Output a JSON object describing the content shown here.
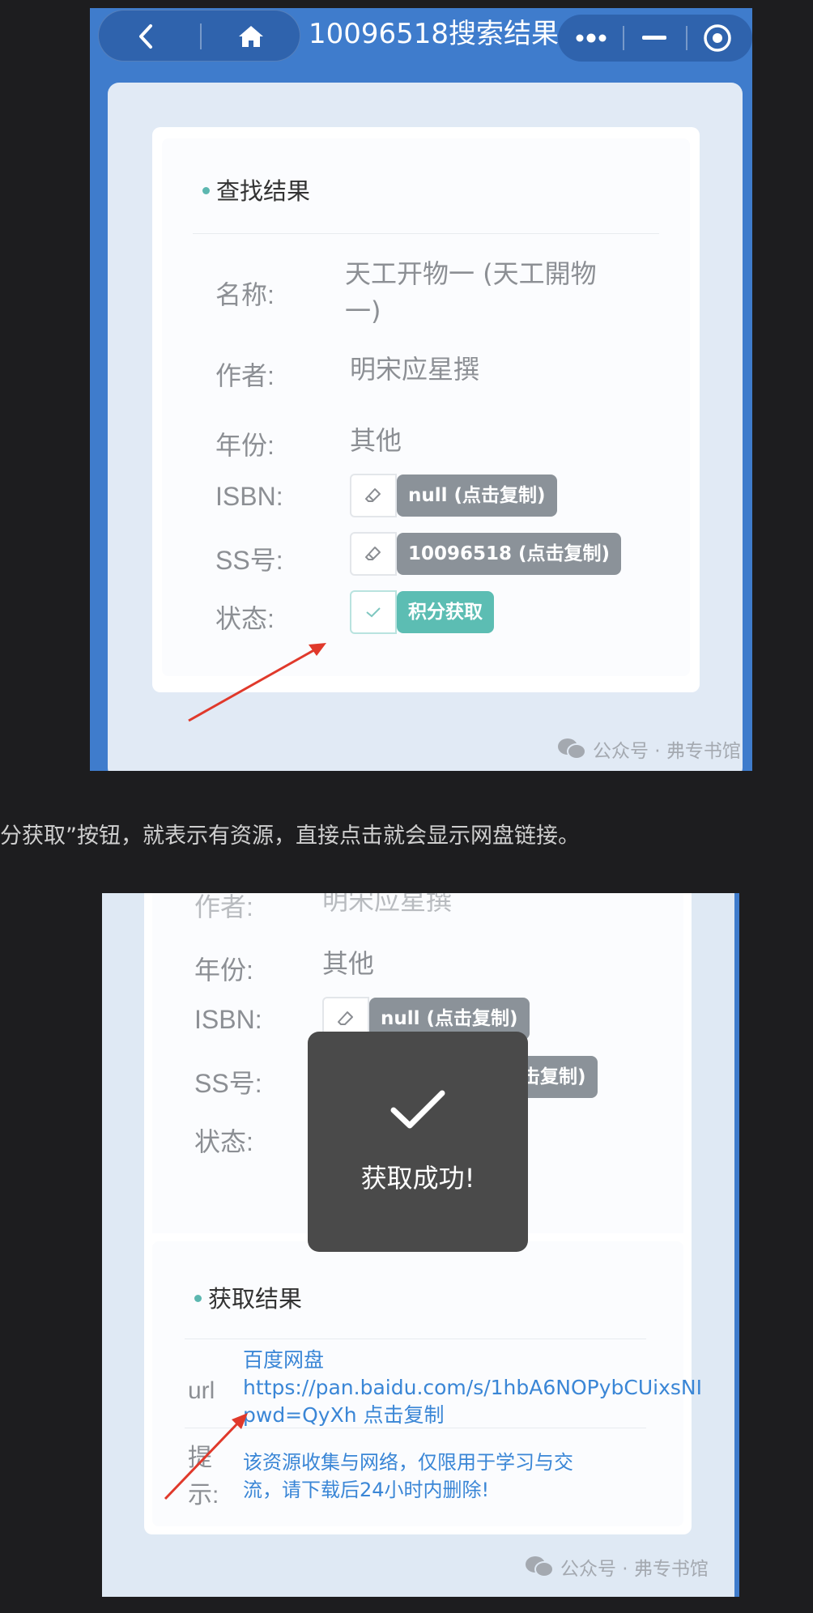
{
  "shot1": {
    "titlebar": {
      "back_icon": "chevron-left-icon",
      "home_icon": "home-icon",
      "title": "10096518搜索结果",
      "more_icon": "more-dots-icon",
      "minimize_icon": "minus-icon",
      "close_icon": "target-icon"
    },
    "section_title": "查找结果",
    "rows": {
      "name_label": "名称:",
      "name_value_line1": "天工开物一 (天工開物",
      "name_value_line2": "一)",
      "author_label": "作者:",
      "author_value": "明宋应星撰",
      "year_label": "年份:",
      "year_value": "其他",
      "isbn_label": "ISBN:",
      "isbn_tag": "null (点击复制)",
      "ss_label": "SS号:",
      "ss_tag": "10096518 (点击复制)",
      "status_label": "状态:",
      "status_button": "积分获取"
    },
    "watermark": "公众号 · 弗专书馆"
  },
  "caption": "分获取”按钮，就表示有资源，直接点击就会显示网盘链接。",
  "shot2": {
    "author_label": "作者:",
    "author_value": "明宋应星撰",
    "year_label": "年份:",
    "year_value": "其他",
    "isbn_label": "ISBN:",
    "isbn_tag": "null (点击复制)",
    "ss_label": "SS号:",
    "ss_tag_partial": "击复制)",
    "status_label": "状态:",
    "toast_text": "获取成功!",
    "result_title": "获取结果",
    "url_label": "url",
    "url_line1": "百度网盘",
    "url_line2": "https://pan.baidu.com/s/1hbA6NOPybCUixsNI",
    "url_line3": "pwd=QyXh 点击复制",
    "tip_label_line1": "提",
    "tip_label_line2": "示:",
    "tip_line1": "该资源收集与网络，仅限用于学习与交",
    "tip_line2": "流，请下载后24小时内删除!",
    "watermark": "公众号 · 弗专书馆"
  },
  "colors": {
    "header_blue": "#3f7ccc",
    "panel_bg": "#e1eaf5",
    "teal": "#5cbdb3",
    "tag_gray": "#8b9299",
    "link_blue": "#3a86d6",
    "arrow_red": "#e0392b"
  }
}
